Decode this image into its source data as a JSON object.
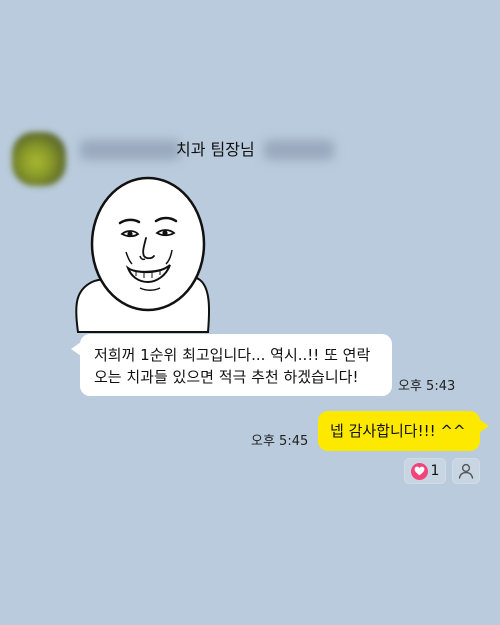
{
  "chat": {
    "sender": {
      "name": "치과 팀장님",
      "avatar_icon": "profile-photo"
    },
    "sticker": {
      "icon": "smirking-face-sticker"
    },
    "messages": [
      {
        "direction": "incoming",
        "lines": [
          "저희꺼 1순위 최고입니다... 역시..!! 또 연락",
          "오는 치과들 있으면 적극 추천 하겠습니다!"
        ],
        "time": "오후 5:43"
      },
      {
        "direction": "outgoing",
        "text": "넵 감사합니다!!! ^^",
        "time": "오후 5:45"
      }
    ],
    "reactions": {
      "like_icon": "heart-icon",
      "like_count": "1",
      "user_icon": "person-icon"
    },
    "colors": {
      "background": "#b9cbdc",
      "incoming_bubble": "#ffffff",
      "outgoing_bubble": "#fde800",
      "heart": "#f2447b"
    }
  }
}
